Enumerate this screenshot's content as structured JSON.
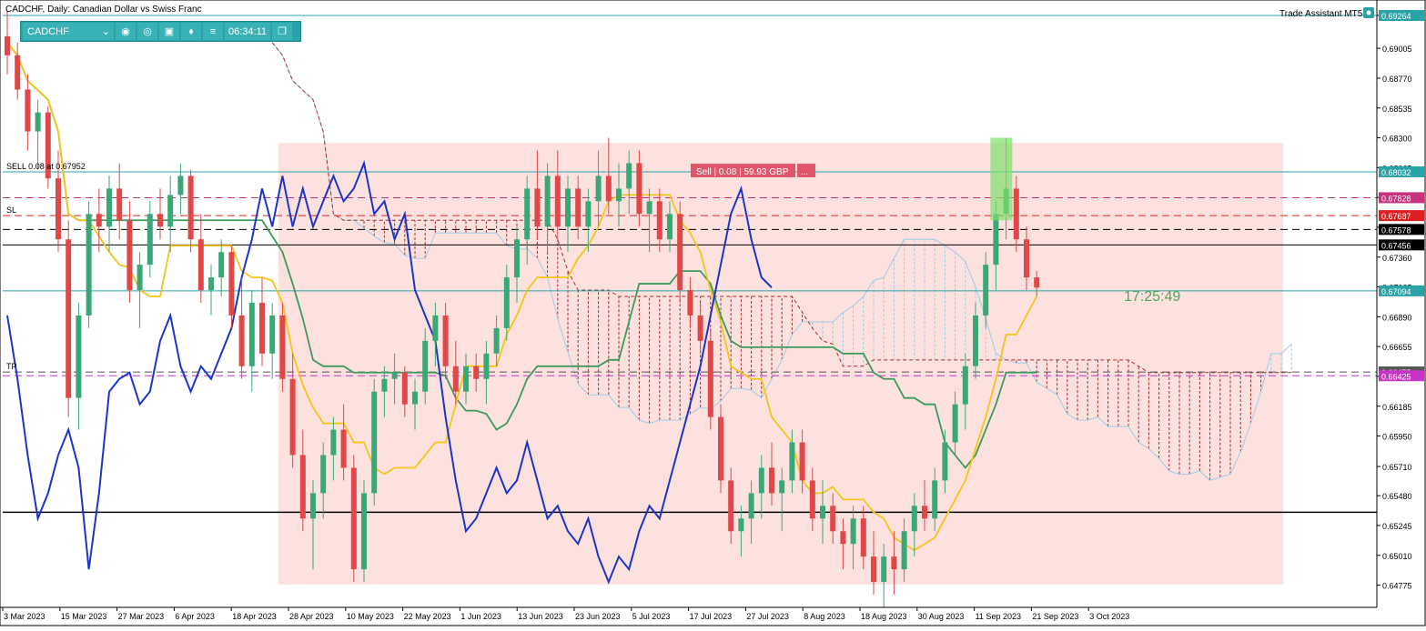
{
  "header": {
    "title": "CADCHF, Daily:  Canadian Dollar vs Swiss Franc",
    "assistant": "Trade Assistant MT5"
  },
  "toolbar": {
    "symbol": "CADCHF",
    "clock": "06:34:11",
    "icons": [
      "camera-icon",
      "eye-icon",
      "calendar-icon",
      "bell-icon",
      "menu-icon",
      "window-icon"
    ]
  },
  "chart_data": {
    "type": "line",
    "ylim": [
      0.646,
      0.6935
    ],
    "price_ticks": [
      "0.69264",
      "0.69005",
      "0.68770",
      "0.68535",
      "0.68300",
      "0.68065",
      "0.67830",
      "0.67595",
      "0.67360",
      "0.67125",
      "0.66890",
      "0.66655",
      "0.66420",
      "0.66185",
      "0.65950",
      "0.65710",
      "0.65480",
      "0.65245",
      "0.65010",
      "0.64775"
    ],
    "x_labels": [
      "3 Mar 2023",
      "15 Mar 2023",
      "27 Mar 2023",
      "6 Apr 2023",
      "18 Apr 2023",
      "28 Apr 2023",
      "10 May 2023",
      "22 May 2023",
      "1 Jun 2023",
      "13 Jun 2023",
      "23 Jun 2023",
      "5 Jul 2023",
      "17 Jul 2023",
      "27 Jul 2023",
      "8 Aug 2023",
      "18 Aug 2023",
      "30 Aug 2023",
      "11 Sep 2023",
      "21 Sep 2023",
      "3 Oct 2023"
    ],
    "levels": [
      {
        "name": "SELL 0.08 at 0.67952",
        "value": 0.68032,
        "label": "0.68032",
        "color": "#2aa3a8",
        "style": "solid"
      },
      {
        "name": "",
        "value": 0.67828,
        "label": "0.67828",
        "color": "#c8327d",
        "style": "dashed"
      },
      {
        "name": "SL",
        "value": 0.67687,
        "label": "0.67687",
        "color": "#e02020",
        "style": "dashed"
      },
      {
        "name": "",
        "value": 0.67578,
        "label": "0.67578",
        "color": "#000000",
        "style": "dashed"
      },
      {
        "name": "",
        "value": 0.67456,
        "label": "0.67456",
        "color": "#000000",
        "style": "solid"
      },
      {
        "name": "",
        "value": 0.67094,
        "label": "0.67094",
        "color": "#2aa3a8",
        "style": "solid"
      },
      {
        "name": "TP",
        "value": 0.66455,
        "label": "0.66455",
        "color": "#555555",
        "style": "dashed"
      },
      {
        "name": "",
        "value": 0.66425,
        "label": "0.66425",
        "color": "#c833c8",
        "style": "dashed"
      },
      {
        "name": "",
        "value": 0.6535,
        "label": "",
        "color": "#000000",
        "style": "solid"
      },
      {
        "name": "",
        "value": 0.69264,
        "label": "0.69264",
        "color": "#2aa3a8",
        "style": "solid"
      }
    ],
    "trade_box_label": "Sell | 0.08 | 59.93 GBP",
    "trade_box_close": "...",
    "countdown": "17:25:49",
    "candles": [
      {
        "o": 0.691,
        "h": 0.693,
        "l": 0.688,
        "c": 0.6895
      },
      {
        "o": 0.6895,
        "h": 0.6905,
        "l": 0.686,
        "c": 0.6868
      },
      {
        "o": 0.6868,
        "h": 0.688,
        "l": 0.682,
        "c": 0.6835
      },
      {
        "o": 0.6835,
        "h": 0.686,
        "l": 0.6805,
        "c": 0.685
      },
      {
        "o": 0.685,
        "h": 0.6855,
        "l": 0.679,
        "c": 0.6798
      },
      {
        "o": 0.6798,
        "h": 0.682,
        "l": 0.674,
        "c": 0.675
      },
      {
        "o": 0.675,
        "h": 0.6765,
        "l": 0.661,
        "c": 0.6625
      },
      {
        "o": 0.6625,
        "h": 0.67,
        "l": 0.66,
        "c": 0.669
      },
      {
        "o": 0.669,
        "h": 0.678,
        "l": 0.668,
        "c": 0.677
      },
      {
        "o": 0.677,
        "h": 0.679,
        "l": 0.674,
        "c": 0.676
      },
      {
        "o": 0.676,
        "h": 0.68,
        "l": 0.674,
        "c": 0.679
      },
      {
        "o": 0.679,
        "h": 0.681,
        "l": 0.675,
        "c": 0.6765
      },
      {
        "o": 0.6765,
        "h": 0.678,
        "l": 0.67,
        "c": 0.671
      },
      {
        "o": 0.671,
        "h": 0.674,
        "l": 0.668,
        "c": 0.673
      },
      {
        "o": 0.673,
        "h": 0.678,
        "l": 0.672,
        "c": 0.677
      },
      {
        "o": 0.677,
        "h": 0.679,
        "l": 0.675,
        "c": 0.676
      },
      {
        "o": 0.676,
        "h": 0.68,
        "l": 0.674,
        "c": 0.6785
      },
      {
        "o": 0.6785,
        "h": 0.681,
        "l": 0.677,
        "c": 0.68
      },
      {
        "o": 0.68,
        "h": 0.6805,
        "l": 0.674,
        "c": 0.675
      },
      {
        "o": 0.675,
        "h": 0.677,
        "l": 0.67,
        "c": 0.671
      },
      {
        "o": 0.671,
        "h": 0.673,
        "l": 0.669,
        "c": 0.672
      },
      {
        "o": 0.672,
        "h": 0.675,
        "l": 0.6705,
        "c": 0.674
      },
      {
        "o": 0.674,
        "h": 0.6745,
        "l": 0.668,
        "c": 0.669
      },
      {
        "o": 0.669,
        "h": 0.672,
        "l": 0.664,
        "c": 0.665
      },
      {
        "o": 0.665,
        "h": 0.671,
        "l": 0.663,
        "c": 0.67
      },
      {
        "o": 0.67,
        "h": 0.672,
        "l": 0.665,
        "c": 0.666
      },
      {
        "o": 0.666,
        "h": 0.67,
        "l": 0.664,
        "c": 0.669
      },
      {
        "o": 0.669,
        "h": 0.67,
        "l": 0.663,
        "c": 0.664
      },
      {
        "o": 0.664,
        "h": 0.666,
        "l": 0.657,
        "c": 0.658
      },
      {
        "o": 0.658,
        "h": 0.66,
        "l": 0.652,
        "c": 0.653
      },
      {
        "o": 0.653,
        "h": 0.656,
        "l": 0.649,
        "c": 0.655
      },
      {
        "o": 0.655,
        "h": 0.659,
        "l": 0.653,
        "c": 0.658
      },
      {
        "o": 0.658,
        "h": 0.661,
        "l": 0.656,
        "c": 0.66
      },
      {
        "o": 0.66,
        "h": 0.662,
        "l": 0.656,
        "c": 0.657
      },
      {
        "o": 0.657,
        "h": 0.658,
        "l": 0.648,
        "c": 0.649
      },
      {
        "o": 0.649,
        "h": 0.656,
        "l": 0.648,
        "c": 0.655
      },
      {
        "o": 0.655,
        "h": 0.664,
        "l": 0.654,
        "c": 0.663
      },
      {
        "o": 0.663,
        "h": 0.665,
        "l": 0.661,
        "c": 0.664
      },
      {
        "o": 0.664,
        "h": 0.666,
        "l": 0.662,
        "c": 0.6645
      },
      {
        "o": 0.6645,
        "h": 0.665,
        "l": 0.661,
        "c": 0.662
      },
      {
        "o": 0.662,
        "h": 0.664,
        "l": 0.66,
        "c": 0.663
      },
      {
        "o": 0.663,
        "h": 0.668,
        "l": 0.662,
        "c": 0.667
      },
      {
        "o": 0.667,
        "h": 0.67,
        "l": 0.665,
        "c": 0.669
      },
      {
        "o": 0.669,
        "h": 0.67,
        "l": 0.664,
        "c": 0.665
      },
      {
        "o": 0.665,
        "h": 0.667,
        "l": 0.662,
        "c": 0.663
      },
      {
        "o": 0.663,
        "h": 0.666,
        "l": 0.662,
        "c": 0.665
      },
      {
        "o": 0.665,
        "h": 0.666,
        "l": 0.663,
        "c": 0.664
      },
      {
        "o": 0.664,
        "h": 0.667,
        "l": 0.662,
        "c": 0.666
      },
      {
        "o": 0.666,
        "h": 0.669,
        "l": 0.665,
        "c": 0.668
      },
      {
        "o": 0.668,
        "h": 0.673,
        "l": 0.667,
        "c": 0.672
      },
      {
        "o": 0.672,
        "h": 0.676,
        "l": 0.67,
        "c": 0.675
      },
      {
        "o": 0.675,
        "h": 0.68,
        "l": 0.673,
        "c": 0.679
      },
      {
        "o": 0.679,
        "h": 0.682,
        "l": 0.675,
        "c": 0.676
      },
      {
        "o": 0.676,
        "h": 0.681,
        "l": 0.674,
        "c": 0.68
      },
      {
        "o": 0.68,
        "h": 0.682,
        "l": 0.675,
        "c": 0.676
      },
      {
        "o": 0.676,
        "h": 0.68,
        "l": 0.674,
        "c": 0.679
      },
      {
        "o": 0.679,
        "h": 0.68,
        "l": 0.675,
        "c": 0.676
      },
      {
        "o": 0.676,
        "h": 0.679,
        "l": 0.674,
        "c": 0.678
      },
      {
        "o": 0.678,
        "h": 0.682,
        "l": 0.676,
        "c": 0.68
      },
      {
        "o": 0.68,
        "h": 0.683,
        "l": 0.677,
        "c": 0.678
      },
      {
        "o": 0.678,
        "h": 0.681,
        "l": 0.676,
        "c": 0.679
      },
      {
        "o": 0.679,
        "h": 0.682,
        "l": 0.677,
        "c": 0.681
      },
      {
        "o": 0.681,
        "h": 0.682,
        "l": 0.676,
        "c": 0.677
      },
      {
        "o": 0.677,
        "h": 0.679,
        "l": 0.674,
        "c": 0.678
      },
      {
        "o": 0.678,
        "h": 0.679,
        "l": 0.674,
        "c": 0.675
      },
      {
        "o": 0.675,
        "h": 0.678,
        "l": 0.674,
        "c": 0.677
      },
      {
        "o": 0.677,
        "h": 0.678,
        "l": 0.67,
        "c": 0.671
      },
      {
        "o": 0.671,
        "h": 0.672,
        "l": 0.668,
        "c": 0.669
      },
      {
        "o": 0.669,
        "h": 0.67,
        "l": 0.666,
        "c": 0.667
      },
      {
        "o": 0.667,
        "h": 0.668,
        "l": 0.66,
        "c": 0.661
      },
      {
        "o": 0.661,
        "h": 0.662,
        "l": 0.655,
        "c": 0.656
      },
      {
        "o": 0.656,
        "h": 0.657,
        "l": 0.651,
        "c": 0.652
      },
      {
        "o": 0.652,
        "h": 0.654,
        "l": 0.65,
        "c": 0.653
      },
      {
        "o": 0.653,
        "h": 0.656,
        "l": 0.651,
        "c": 0.655
      },
      {
        "o": 0.655,
        "h": 0.658,
        "l": 0.653,
        "c": 0.657
      },
      {
        "o": 0.657,
        "h": 0.659,
        "l": 0.654,
        "c": 0.655
      },
      {
        "o": 0.655,
        "h": 0.657,
        "l": 0.652,
        "c": 0.656
      },
      {
        "o": 0.656,
        "h": 0.66,
        "l": 0.655,
        "c": 0.659
      },
      {
        "o": 0.659,
        "h": 0.66,
        "l": 0.655,
        "c": 0.656
      },
      {
        "o": 0.656,
        "h": 0.657,
        "l": 0.652,
        "c": 0.653
      },
      {
        "o": 0.653,
        "h": 0.656,
        "l": 0.651,
        "c": 0.654
      },
      {
        "o": 0.654,
        "h": 0.655,
        "l": 0.651,
        "c": 0.652
      },
      {
        "o": 0.652,
        "h": 0.653,
        "l": 0.649,
        "c": 0.651
      },
      {
        "o": 0.651,
        "h": 0.654,
        "l": 0.649,
        "c": 0.653
      },
      {
        "o": 0.653,
        "h": 0.654,
        "l": 0.649,
        "c": 0.65
      },
      {
        "o": 0.65,
        "h": 0.652,
        "l": 0.647,
        "c": 0.648
      },
      {
        "o": 0.648,
        "h": 0.651,
        "l": 0.646,
        "c": 0.65
      },
      {
        "o": 0.65,
        "h": 0.652,
        "l": 0.647,
        "c": 0.649
      },
      {
        "o": 0.649,
        "h": 0.653,
        "l": 0.648,
        "c": 0.652
      },
      {
        "o": 0.652,
        "h": 0.655,
        "l": 0.65,
        "c": 0.654
      },
      {
        "o": 0.654,
        "h": 0.656,
        "l": 0.652,
        "c": 0.653
      },
      {
        "o": 0.653,
        "h": 0.657,
        "l": 0.652,
        "c": 0.656
      },
      {
        "o": 0.656,
        "h": 0.66,
        "l": 0.655,
        "c": 0.659
      },
      {
        "o": 0.659,
        "h": 0.663,
        "l": 0.658,
        "c": 0.662
      },
      {
        "o": 0.662,
        "h": 0.666,
        "l": 0.66,
        "c": 0.665
      },
      {
        "o": 0.665,
        "h": 0.67,
        "l": 0.664,
        "c": 0.669
      },
      {
        "o": 0.669,
        "h": 0.674,
        "l": 0.668,
        "c": 0.673
      },
      {
        "o": 0.673,
        "h": 0.678,
        "l": 0.671,
        "c": 0.677
      },
      {
        "o": 0.677,
        "h": 0.683,
        "l": 0.675,
        "c": 0.679
      },
      {
        "o": 0.679,
        "h": 0.68,
        "l": 0.674,
        "c": 0.675
      },
      {
        "o": 0.675,
        "h": 0.676,
        "l": 0.671,
        "c": 0.672
      },
      {
        "o": 0.672,
        "h": 0.6725,
        "l": 0.6705,
        "c": 0.6712
      }
    ]
  }
}
